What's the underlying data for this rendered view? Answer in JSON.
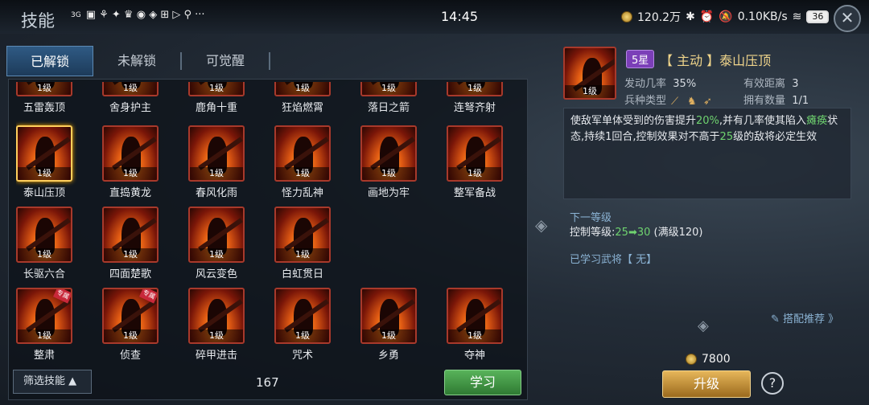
{
  "status": {
    "time": "14:45",
    "carrier": "3G",
    "gold": "120.2万",
    "net_speed": "0.10KB/s",
    "battery": "36"
  },
  "header": {
    "title": "技能"
  },
  "tabs": [
    {
      "label": "已解锁"
    },
    {
      "label": "未解锁"
    },
    {
      "label": "可觉醒"
    }
  ],
  "grid": {
    "top_partial": [
      "五雷轰顶",
      "舍身护主",
      "鹿角十重",
      "狂焰燃霄",
      "落日之箭",
      "连弩齐射"
    ],
    "level_label": "1级",
    "row1": [
      "泰山压顶",
      "直捣黄龙",
      "春风化雨",
      "怪力乱神",
      "画地为牢",
      "整军备战"
    ],
    "row2": [
      "长驱六合",
      "四面楚歌",
      "风云变色",
      "白虹贯日"
    ],
    "row3": [
      "整肃",
      "侦查",
      "碎甲进击",
      "咒术",
      "乡勇",
      "夺神"
    ],
    "tag_label": "专属"
  },
  "footer": {
    "filter_label": "筛选技能",
    "count": "167",
    "learn_label": "学习"
  },
  "detail": {
    "level": "1级",
    "star": "5星",
    "name": "【 主动 】泰山压顶",
    "rate_label": "发动几率",
    "rate_value": "35%",
    "range_label": "有效距离",
    "range_value": "3",
    "troop_label": "兵种类型",
    "own_label": "拥有数量",
    "own_value": "1/1",
    "desc_a": "使敌军单体受到的伤害提升",
    "desc_pct": "20%",
    "desc_b": ",并有几率使其陷入",
    "desc_status": "瘫痪",
    "desc_c": "状态,持续1回合,控制效果对不高于",
    "desc_lv": "25",
    "desc_d": "级的敌将必定生效",
    "next_label": "下一等级",
    "ctrl_label": "控制等级:",
    "ctrl_from": "25",
    "ctrl_to": "30",
    "ctrl_max": "(满级120)",
    "learned": "已学习武将【 无】",
    "rec": "搭配推荐 》",
    "cost": "7800",
    "upgrade_label": "升级",
    "help": "?"
  }
}
